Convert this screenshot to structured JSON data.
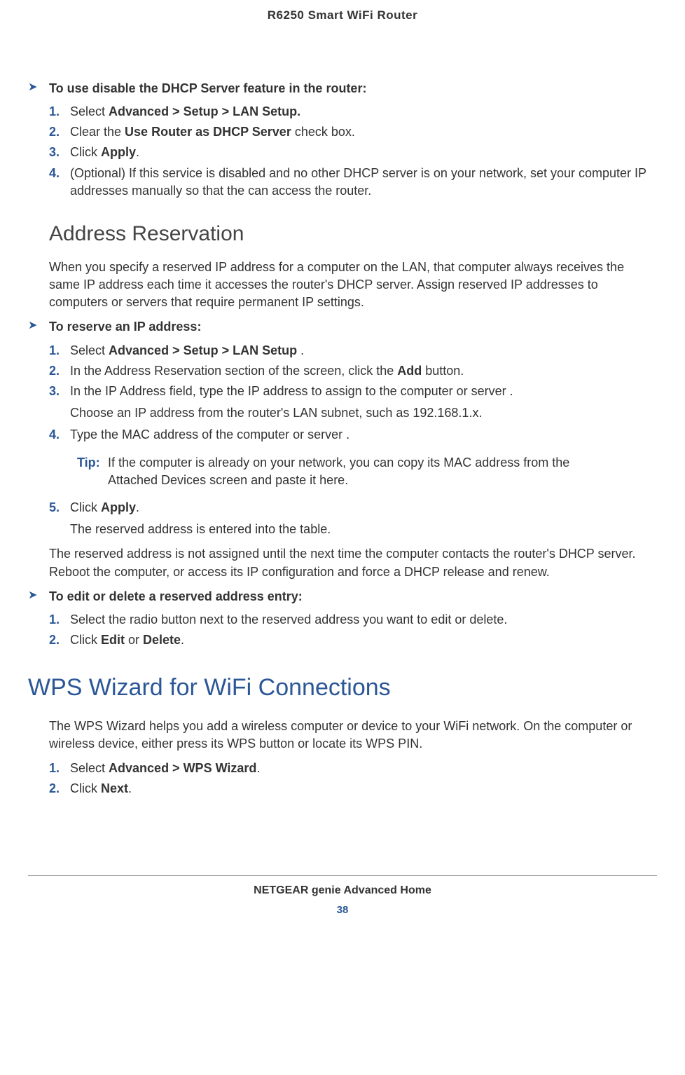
{
  "header": "R6250 Smart WiFi Router",
  "proc1": {
    "title": "To use disable the DHCP Server feature in the router:",
    "steps": [
      {
        "n": "1.",
        "pre": "Select ",
        "bold": "Advanced > Setup > LAN Setup.",
        "post": ""
      },
      {
        "n": "2.",
        "pre": "Clear the ",
        "bold": "Use Router as DHCP Server",
        "post": " check box."
      },
      {
        "n": "3.",
        "pre": "Click ",
        "bold": "Apply",
        "post": "."
      },
      {
        "n": "4.",
        "pre": "(Optional) If this service is disabled and no other DHCP server is on your network, set your computer IP addresses manually so that the can access the router.",
        "bold": "",
        "post": ""
      }
    ]
  },
  "section1": {
    "heading": "Address Reservation",
    "intro": "When you specify a reserved IP address for a computer on the LAN, that computer always receives the same IP address each time it accesses the router's DHCP server. Assign reserved IP addresses to computers or servers that require permanent IP settings."
  },
  "proc2": {
    "title": "To reserve an IP address:",
    "step1": {
      "n": "1.",
      "pre": "Select ",
      "bold": "Advanced > Setup > LAN Setup",
      "post": " ."
    },
    "step2": {
      "n": "2.",
      "pre": "In the Address Reservation section of the screen, click the ",
      "bold": "Add",
      "post": " button."
    },
    "step3": {
      "n": "3.",
      "text": "In the IP Address field, type the IP address to assign to the computer or server .",
      "sub": "Choose an IP address from the router's LAN subnet, such as 192.168.1.x."
    },
    "step4": {
      "n": "4.",
      "text": "Type the MAC address of the computer or server ."
    },
    "tip": {
      "label": "Tip:",
      "text": "If the computer is already on your network, you can copy its MAC address from the Attached Devices screen and paste it here."
    },
    "step5": {
      "n": "5.",
      "pre": "Click ",
      "bold": "Apply",
      "post": ".",
      "sub": "The reserved address is entered into the table."
    },
    "after": "The reserved address is not assigned until the next time the computer contacts the router's DHCP server. Reboot the computer, or access its IP configuration and force a DHCP release and renew."
  },
  "proc3": {
    "title": "To edit or delete a reserved address entry:",
    "step1": {
      "n": "1.",
      "text": "Select the radio button next to the reserved address you want to edit or delete."
    },
    "step2": {
      "n": "2.",
      "pre": "Click ",
      "bold1": "Edit",
      "mid": " or ",
      "bold2": "Delete",
      "post": "."
    }
  },
  "major": {
    "heading": "WPS Wizard for WiFi Connections",
    "intro": "The WPS Wizard helps you add a wireless computer or device to your WiFi network. On the computer or wireless device, either press its WPS button or locate its WPS PIN.",
    "step1": {
      "n": "1.",
      "pre": "Select ",
      "bold": "Advanced > WPS Wizard",
      "post": "."
    },
    "step2": {
      "n": "2.",
      "pre": "Click ",
      "bold": "Next",
      "post": "."
    }
  },
  "footer": {
    "title": "NETGEAR genie Advanced Home",
    "page": "38"
  }
}
